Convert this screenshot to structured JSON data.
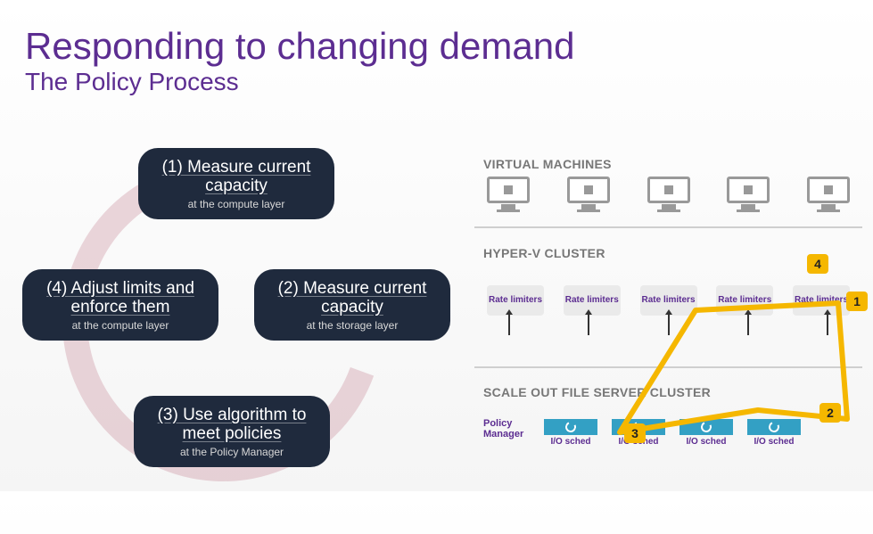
{
  "title": "Responding to changing demand",
  "subtitle": "The Policy Process",
  "steps": {
    "s1": {
      "title": "(1) Measure current capacity",
      "sub": "at the compute layer"
    },
    "s2": {
      "title": "(2) Measure current capacity",
      "sub": "at the storage layer"
    },
    "s3": {
      "title": "(3) Use algorithm to meet policies",
      "sub": "at the Policy Manager"
    },
    "s4": {
      "title": "(4) Adjust limits and enforce them",
      "sub": "at the compute layer"
    }
  },
  "panels": {
    "vm": "VIRTUAL MACHINES",
    "hv": "HYPER-V CLUSTER",
    "fs": "SCALE OUT FILE SERVER CLUSTER"
  },
  "rate_limiter": "Rate limiters",
  "policy_manager": "Policy Manager",
  "io_sched": "I/O sched",
  "badges": {
    "b1": "1",
    "b2": "2",
    "b3": "3",
    "b4": "4"
  }
}
